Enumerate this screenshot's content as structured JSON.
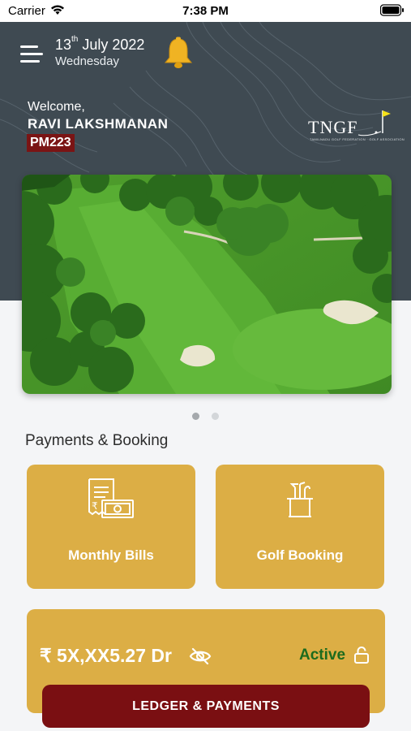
{
  "status_bar": {
    "carrier": "Carrier",
    "time": "7:38 PM"
  },
  "header": {
    "date_day_number": "13",
    "date_suffix": "th",
    "date_rest": " July 2022",
    "weekday": "Wednesday",
    "welcome": "Welcome,",
    "user_name": "RAVI LAKSHMANAN",
    "member_id": "PM223",
    "logo_text": "TNGF",
    "logo_subtext": "TAMILNADU GOLF FEDERATION · GOLF ASSOCIATION"
  },
  "carousel": {
    "active_index": 0,
    "count": 2,
    "active_color": "#a5a9ad",
    "inactive_color": "#d3d6d9"
  },
  "section": {
    "title": "Payments & Booking"
  },
  "tiles": [
    {
      "label": "Monthly Bills",
      "icon": "bill-receipt-icon"
    },
    {
      "label": "Golf Booking",
      "icon": "golf-bag-icon"
    }
  ],
  "account": {
    "balance": "₹ 5X,XX5.27 Dr",
    "status": "Active",
    "status_color": "#1d6b1d",
    "icons": [
      "eye-off-icon",
      "lock-icon"
    ]
  },
  "ledger_button": {
    "label": "LEDGER & PAYMENTS"
  },
  "colors": {
    "header_bg": "#3f4a52",
    "tile_gold": "#dcae45",
    "button_maroon": "#7a0f12",
    "badge_red": "#7a1414",
    "bell_gold": "#f0b323"
  }
}
